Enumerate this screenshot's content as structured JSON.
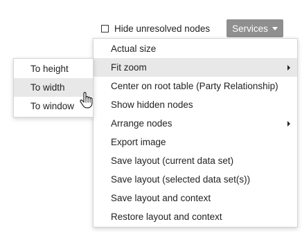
{
  "toolbar": {
    "hide_unresolved_label": "Hide unresolved nodes",
    "hide_unresolved_checked": false,
    "services_label": "Services"
  },
  "main_menu": {
    "items": [
      {
        "label": "Actual size",
        "has_submenu": false
      },
      {
        "label": "Fit zoom",
        "has_submenu": true
      },
      {
        "label": "Center on root table (Party Relationship)",
        "has_submenu": false
      },
      {
        "label": "Show hidden nodes",
        "has_submenu": false
      },
      {
        "label": "Arrange nodes",
        "has_submenu": true
      },
      {
        "label": "Export image",
        "has_submenu": false
      },
      {
        "label": "Save layout (current data set)",
        "has_submenu": false
      },
      {
        "label": "Save layout (selected data set(s))",
        "has_submenu": false
      },
      {
        "label": "Save layout and context",
        "has_submenu": false
      },
      {
        "label": "Restore layout and context",
        "has_submenu": false
      }
    ],
    "active_item": "Fit zoom"
  },
  "sub_menu": {
    "items": [
      {
        "label": "To height"
      },
      {
        "label": "To width"
      },
      {
        "label": "To window"
      }
    ],
    "hovered_item": "To width"
  },
  "colors": {
    "services_button_bg": "#8f8f8f",
    "highlight_bg": "#e8e8e8",
    "menu_border": "#d5d5d5"
  },
  "icons": {
    "cursor": "hand-pointer-icon",
    "submenu_arrow": "chevron-right-icon",
    "dropdown_caret": "caret-down-icon"
  }
}
